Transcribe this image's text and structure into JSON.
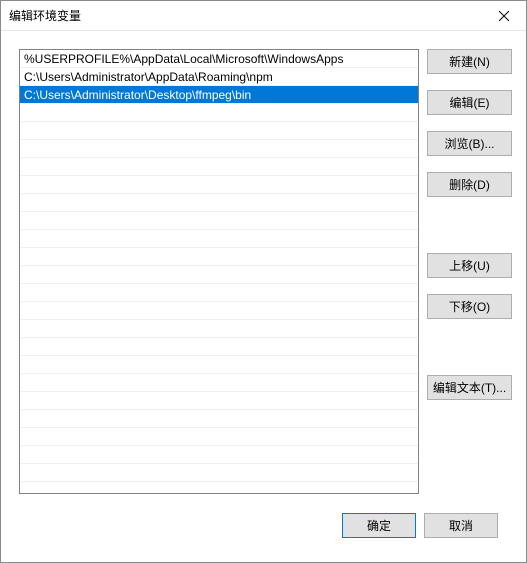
{
  "window": {
    "title": "编辑环境变量"
  },
  "list": {
    "rows": [
      {
        "value": "%USERPROFILE%\\AppData\\Local\\Microsoft\\WindowsApps",
        "selected": false
      },
      {
        "value": "C:\\Users\\Administrator\\AppData\\Roaming\\npm",
        "selected": false
      },
      {
        "value": "C:\\Users\\Administrator\\Desktop\\ffmpeg\\bin",
        "selected": true
      }
    ],
    "total_visible_rows": 24
  },
  "buttons": {
    "new": "新建(N)",
    "edit": "编辑(E)",
    "browse": "浏览(B)...",
    "delete": "删除(D)",
    "move_up": "上移(U)",
    "move_down": "下移(O)",
    "edit_text": "编辑文本(T)...",
    "ok": "确定",
    "cancel": "取消"
  }
}
